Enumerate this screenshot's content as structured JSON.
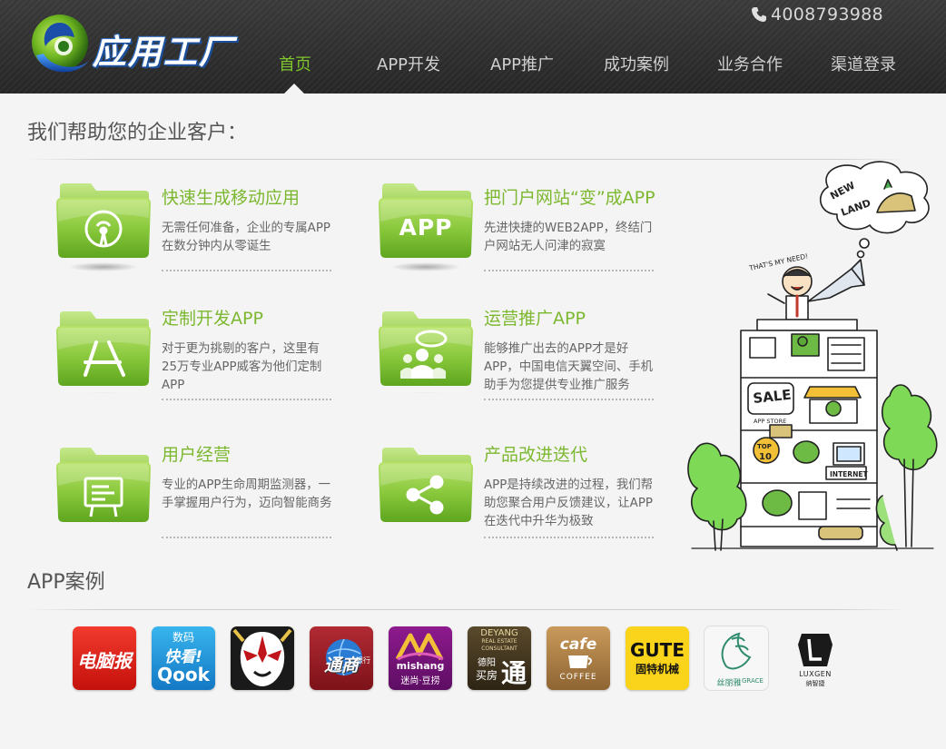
{
  "header": {
    "logo_text": "应用工厂",
    "phone": "4008793988",
    "nav": [
      {
        "label": "首页",
        "active": true
      },
      {
        "label": "APP开发",
        "active": false
      },
      {
        "label": "APP推广",
        "active": false
      },
      {
        "label": "成功案例",
        "active": false
      },
      {
        "label": "业务合作",
        "active": false
      },
      {
        "label": "渠道登录",
        "active": false
      }
    ]
  },
  "services": {
    "heading": "我们帮助您的企业客户：",
    "items": [
      {
        "title": "快速生成移动应用",
        "desc": "无需任何准备，企业的专属APP在数分钟内从零诞生",
        "icon": "broadcast-icon"
      },
      {
        "title": "把门户网站“变”成APP",
        "desc": "先进快捷的WEB2APP，终结门户网站无人问津的寂寞",
        "icon": "app-text-icon",
        "icon_text": "APP"
      },
      {
        "title": "定制开发APP",
        "desc": "对于更为挑剔的客户，这里有25万专业APP威客为他们定制APP",
        "icon": "app-store-icon"
      },
      {
        "title": "运营推广APP",
        "desc": "能够推广出去的APP才是好APP，中国电信天翼空间、手机助手为您提供专业推广服务",
        "icon": "speaker-icon"
      },
      {
        "title": "用户经营",
        "desc": "专业的APP生命周期监测器，一手掌握用户行为，迈向智能商务",
        "icon": "monitor-board-icon"
      },
      {
        "title": "产品改进迭代",
        "desc": "APP是持续改进的过程，我们帮助您聚合用户反馈建议，让APP在迭代中升华为极致",
        "icon": "share-icon"
      }
    ]
  },
  "illustration": {
    "bubble_text_1": "NEW",
    "bubble_text_2": "LAND",
    "speech": "THAT'S MY NEED!",
    "sign_sale": "SALE",
    "sign_store": "APP STORE",
    "sign_top": "TOP",
    "sign_top_num": "10",
    "sign_internet": "INTERNET"
  },
  "cases": {
    "heading": "APP案例",
    "items": [
      {
        "name": "dnb",
        "line1": "电脑报",
        "line2": ""
      },
      {
        "name": "qook",
        "line1": "数码",
        "line2": "快看!",
        "line3": "Qook"
      },
      {
        "name": "opera-mask",
        "line1": "",
        "line2": ""
      },
      {
        "name": "tongshang",
        "line1": "通商",
        "line2": "银行"
      },
      {
        "name": "mishang",
        "line1": "mishang",
        "line2": "迷尚·豆捞"
      },
      {
        "name": "deyang",
        "line1": "DEYANG",
        "line2": "REAL ESTATE",
        "line3": "CONSULTANT",
        "line4": "德阳",
        "line5": "买房",
        "line6": "通"
      },
      {
        "name": "cafe",
        "line1": "cafe",
        "line2": "COFFEE"
      },
      {
        "name": "gute",
        "line1": "GUTE",
        "line2": "固特机械"
      },
      {
        "name": "grace",
        "line1": "丝丽雅",
        "line2": "GRACE"
      },
      {
        "name": "luxgen",
        "line1": "LUXGEN",
        "line2": "纳智捷"
      }
    ]
  },
  "colors": {
    "accent_green": "#7cb82f",
    "header_bg": "#2d2d2d",
    "page_bg": "#f4f4f4"
  }
}
